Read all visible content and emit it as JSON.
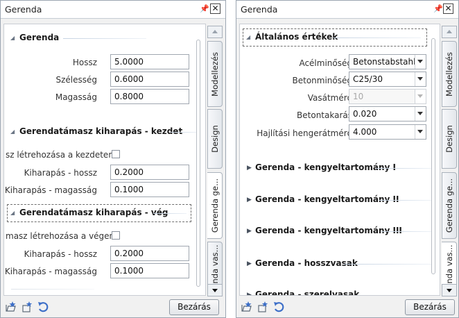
{
  "left_panel": {
    "title": "Gerenda",
    "pin_glyph": "📌",
    "close_glyph": "✕",
    "sections": {
      "s1": "Gerenda",
      "s2": "Gerendatámasz kiharapás - kezdet",
      "s3": "Gerendatámasz kiharapás - vég"
    },
    "fields": {
      "hossz_label": "Hossz",
      "hossz_value": "5.0000",
      "szelesseg_label": "Szélesség",
      "szelesseg_value": "0.6000",
      "magassag_label": "Magasság",
      "magassag_value": "0.8000",
      "k_create_label": "sz létrehozása a kezdeten",
      "k_hossz_label": "Kiharapás - hossz",
      "k_hossz_value": "0.2000",
      "k_mag_label": "Kiharapás - magasság",
      "k_mag_value": "0.1000",
      "v_create_label": "masz létrehozása a végen",
      "v_hossz_label": "Kiharapás - hossz",
      "v_hossz_value": "0.2000",
      "v_mag_label": "Kiharapás - magasság",
      "v_mag_value": "0.1000"
    },
    "tabs": {
      "t1": "Modellezés",
      "t2": "Design",
      "t3": "Gerenda ge...",
      "t4": "enda vas..."
    },
    "close_button": "Bezárás"
  },
  "right_panel": {
    "title": "Gerenda",
    "pin_glyph": "📌",
    "close_glyph": "✕",
    "sections": {
      "s1": "Általános értékek",
      "s2": "Gerenda - kengyeltartomány I",
      "s3": "Gerenda - kengyeltartomány II",
      "s4": "Gerenda - kengyeltartomány III",
      "s5": "Gerenda - hosszvasak",
      "s6": "Gerenda - szerelvasak"
    },
    "fields": {
      "acel_label": "Acélminőség",
      "acel_value": "Betonstabstahl (",
      "beton_label": "Betonminőség",
      "beton_value": "C25/30",
      "vasatmero_label": "Vasátmérő",
      "vasatmero_value": "10",
      "takaras_label": "Betontakarás",
      "takaras_value": "0.020",
      "hajlitasi_label": "Hajlítási hengerátmérő",
      "hajlitasi_value": "4.000"
    },
    "tabs": {
      "t1": "Modellezés",
      "t2": "Design",
      "t3": "Gerenda ge...",
      "t4": "enda vas..."
    },
    "close_button": "Bezárás"
  },
  "icons": [
    "folder-star-icon",
    "star-settings-icon",
    "undo-icon"
  ],
  "colors": {
    "accent_blue": "#2e63c7",
    "section_line": "#c6d3e2"
  }
}
